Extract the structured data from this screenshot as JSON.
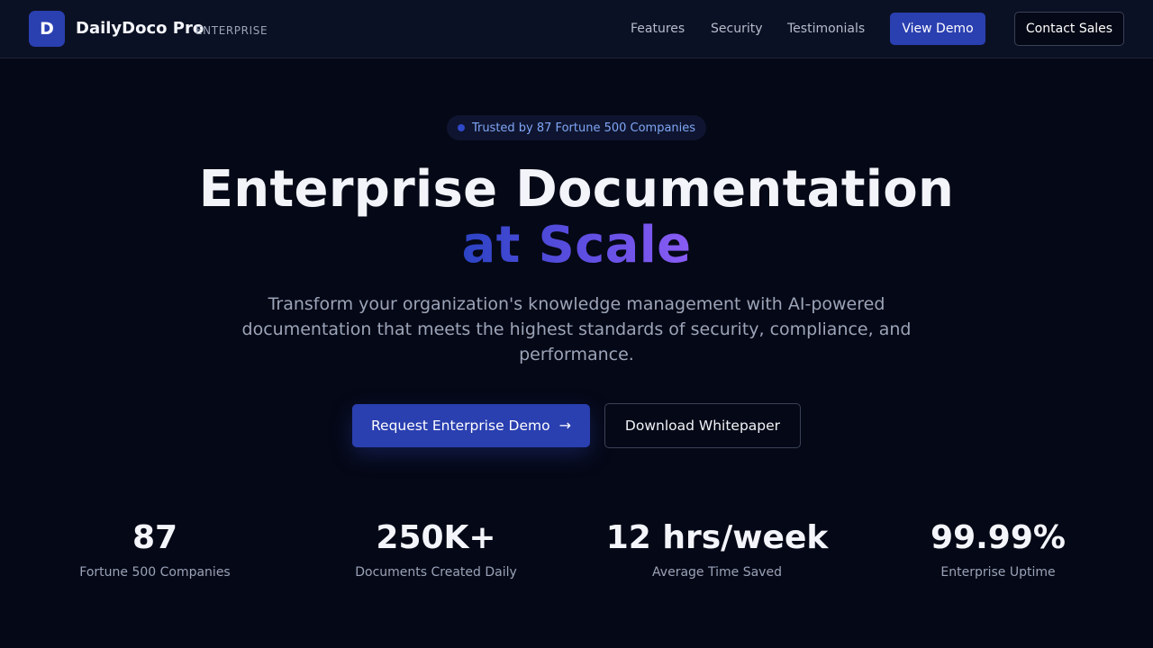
{
  "header": {
    "logo_letter": "D",
    "brand_name": "DailyDoco Pro",
    "brand_tag": "ENTERPRISE",
    "nav": {
      "features": "Features",
      "security": "Security",
      "testimonials": "Testimonials"
    },
    "view_demo_label": "View Demo",
    "contact_sales_label": "Contact Sales"
  },
  "hero": {
    "badge_text": "Trusted by 87 Fortune 500 Companies",
    "title_line1": "Enterprise Documentation",
    "title_line2": "at Scale",
    "subtitle": "Transform your organization's knowledge management with AI-powered documentation that meets the highest standards of security, compliance, and performance.",
    "primary_cta": "Request Enterprise Demo",
    "primary_cta_icon": "→",
    "secondary_cta": "Download Whitepaper"
  },
  "stats": [
    {
      "value": "87",
      "label": "Fortune 500 Companies"
    },
    {
      "value": "250K+",
      "label": "Documents Created Daily"
    },
    {
      "value": "12 hrs/week",
      "label": "Average Time Saved"
    },
    {
      "value": "99.99%",
      "label": "Enterprise Uptime"
    }
  ],
  "colors": {
    "background": "#050816",
    "header_background": "#0b1124",
    "accent": "#2a3fb0",
    "gradient_start": "#2c43c4",
    "gradient_end": "#8a5cf5",
    "badge_text": "#7fa6f5"
  },
  "icons": {
    "arrow": "arrow-right-icon",
    "badge_dot": "status-dot-icon"
  }
}
